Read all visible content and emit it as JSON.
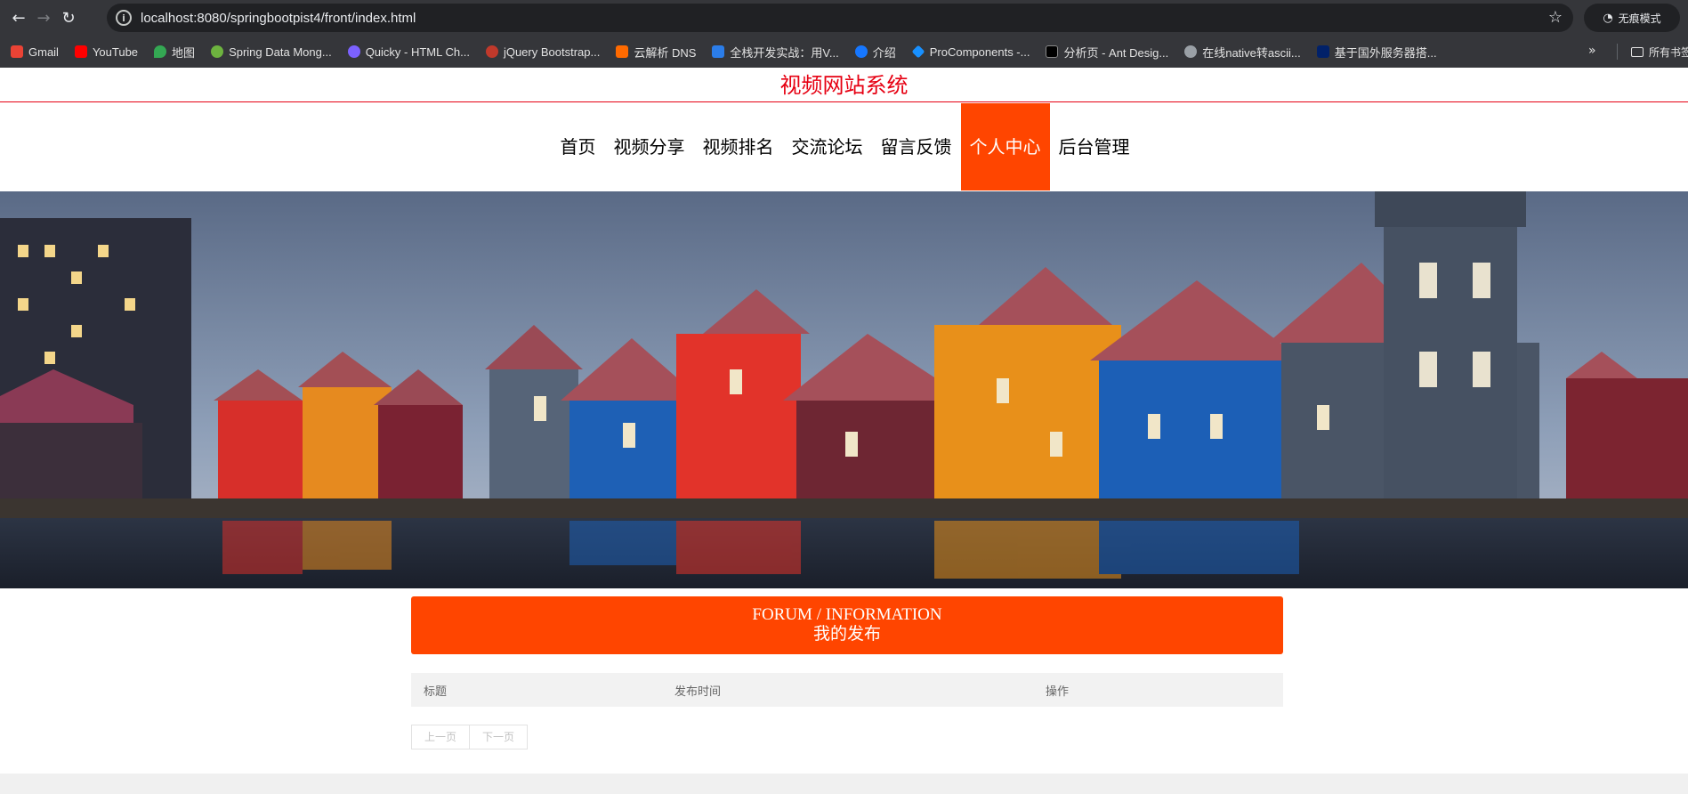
{
  "browser": {
    "url": "localhost:8080/springbootpist4/front/index.html",
    "incognito_label": "无痕模式",
    "bookmarks": [
      {
        "label": "Gmail",
        "color": "#ea4335"
      },
      {
        "label": "YouTube",
        "color": "#ff0000"
      },
      {
        "label": "地图",
        "color": "#34a853"
      },
      {
        "label": "Spring Data Mong...",
        "color": "#6db33f"
      },
      {
        "label": "Quicky - HTML Ch...",
        "color": "#7b61ff"
      },
      {
        "label": "jQuery Bootstrap...",
        "color": "#c0392b"
      },
      {
        "label": "云解析 DNS",
        "color": "#ff6a00"
      },
      {
        "label": "全栈开发实战：用V...",
        "color": "#2b7de9"
      },
      {
        "label": "介绍",
        "color": "#1677ff"
      },
      {
        "label": "ProComponents -...",
        "color": "#1890ff"
      },
      {
        "label": "分析页 - Ant Desig...",
        "color": "#000000"
      },
      {
        "label": "在线native转ascii...",
        "color": "#9aa0a6"
      },
      {
        "label": "基于国外服务器搭...",
        "color": "#012169"
      }
    ],
    "all_bookmarks_label": "所有书签"
  },
  "site": {
    "title": "视频网站系统",
    "nav": [
      {
        "label": "首页",
        "active": false
      },
      {
        "label": "视频分享",
        "active": false
      },
      {
        "label": "视频排名",
        "active": false
      },
      {
        "label": "交流论坛",
        "active": false
      },
      {
        "label": "留言反馈",
        "active": false
      },
      {
        "label": "个人中心",
        "active": true
      },
      {
        "label": "后台管理",
        "active": false
      }
    ],
    "accent_color": "#ff4500"
  },
  "panel": {
    "title_en": "FORUM / INFORMATION",
    "title_zh": "我的发布"
  },
  "table": {
    "columns": [
      "标题",
      "发布时间",
      "操作"
    ],
    "rows": []
  },
  "pager": {
    "prev": "上一页",
    "next": "下一页"
  }
}
